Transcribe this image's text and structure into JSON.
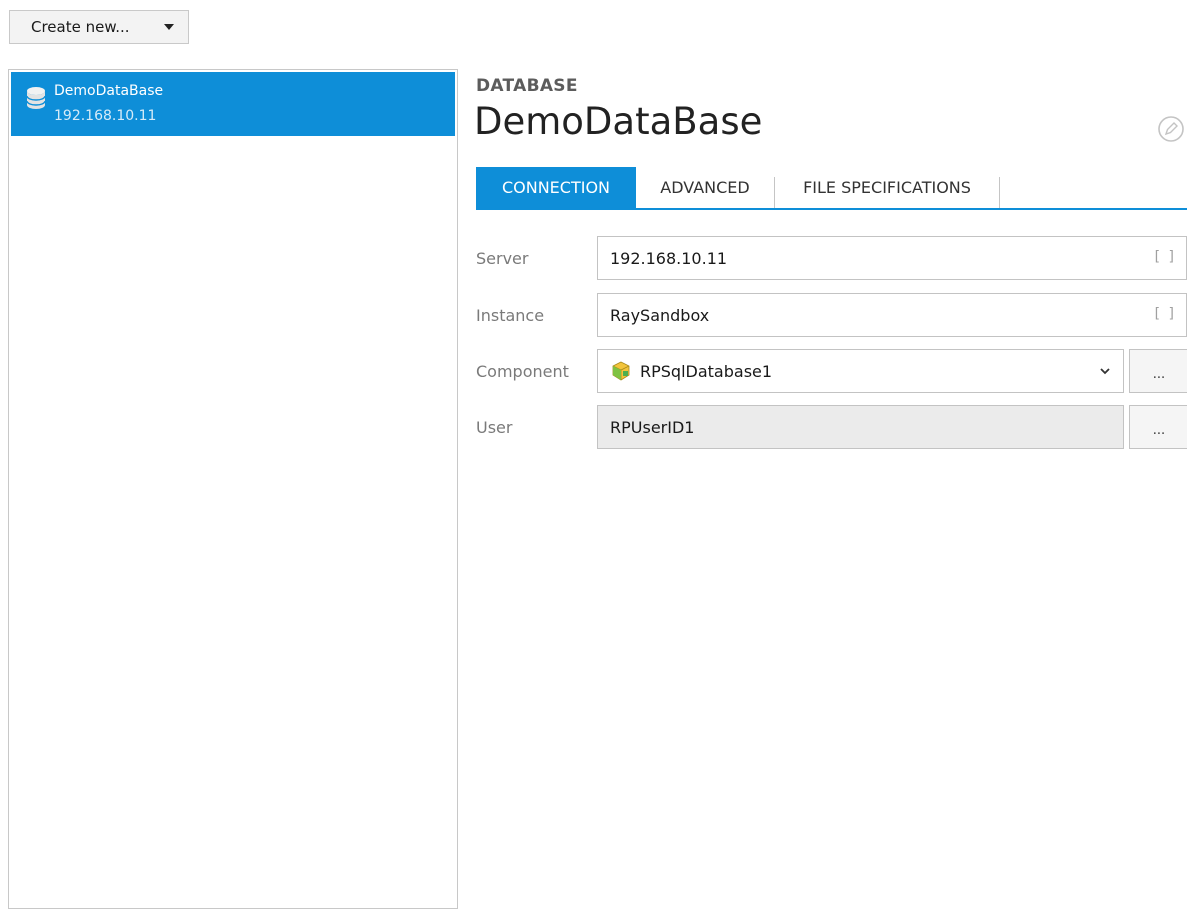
{
  "toolbar": {
    "create_new_label": "Create new..."
  },
  "database_list": {
    "items": [
      {
        "name": "DemoDataBase",
        "address": "192.168.10.11"
      }
    ]
  },
  "detail": {
    "section_label": "DATABASE",
    "title": "DemoDataBase",
    "tabs": [
      {
        "label": "CONNECTION",
        "active": true
      },
      {
        "label": "ADVANCED",
        "active": false
      },
      {
        "label": "FILE SPECIFICATIONS",
        "active": false
      }
    ],
    "fields": {
      "server": {
        "label": "Server",
        "value": "192.168.10.11",
        "placeholder_marker": "[ ]"
      },
      "instance": {
        "label": "Instance",
        "value": "RaySandbox",
        "placeholder_marker": "[ ]"
      },
      "component": {
        "label": "Component",
        "value": "RPSqlDatabase1",
        "browse_label": "..."
      },
      "user": {
        "label": "User",
        "value": "RPUserID1",
        "browse_label": "..."
      }
    }
  },
  "colors": {
    "accent": "#0e8ed8",
    "selected_text": "#ffffff"
  },
  "icons": {
    "database": "database-icon",
    "edit": "edit-pencil-icon",
    "component": "component-cube-icon",
    "dropdown": "chevron-down-icon"
  }
}
